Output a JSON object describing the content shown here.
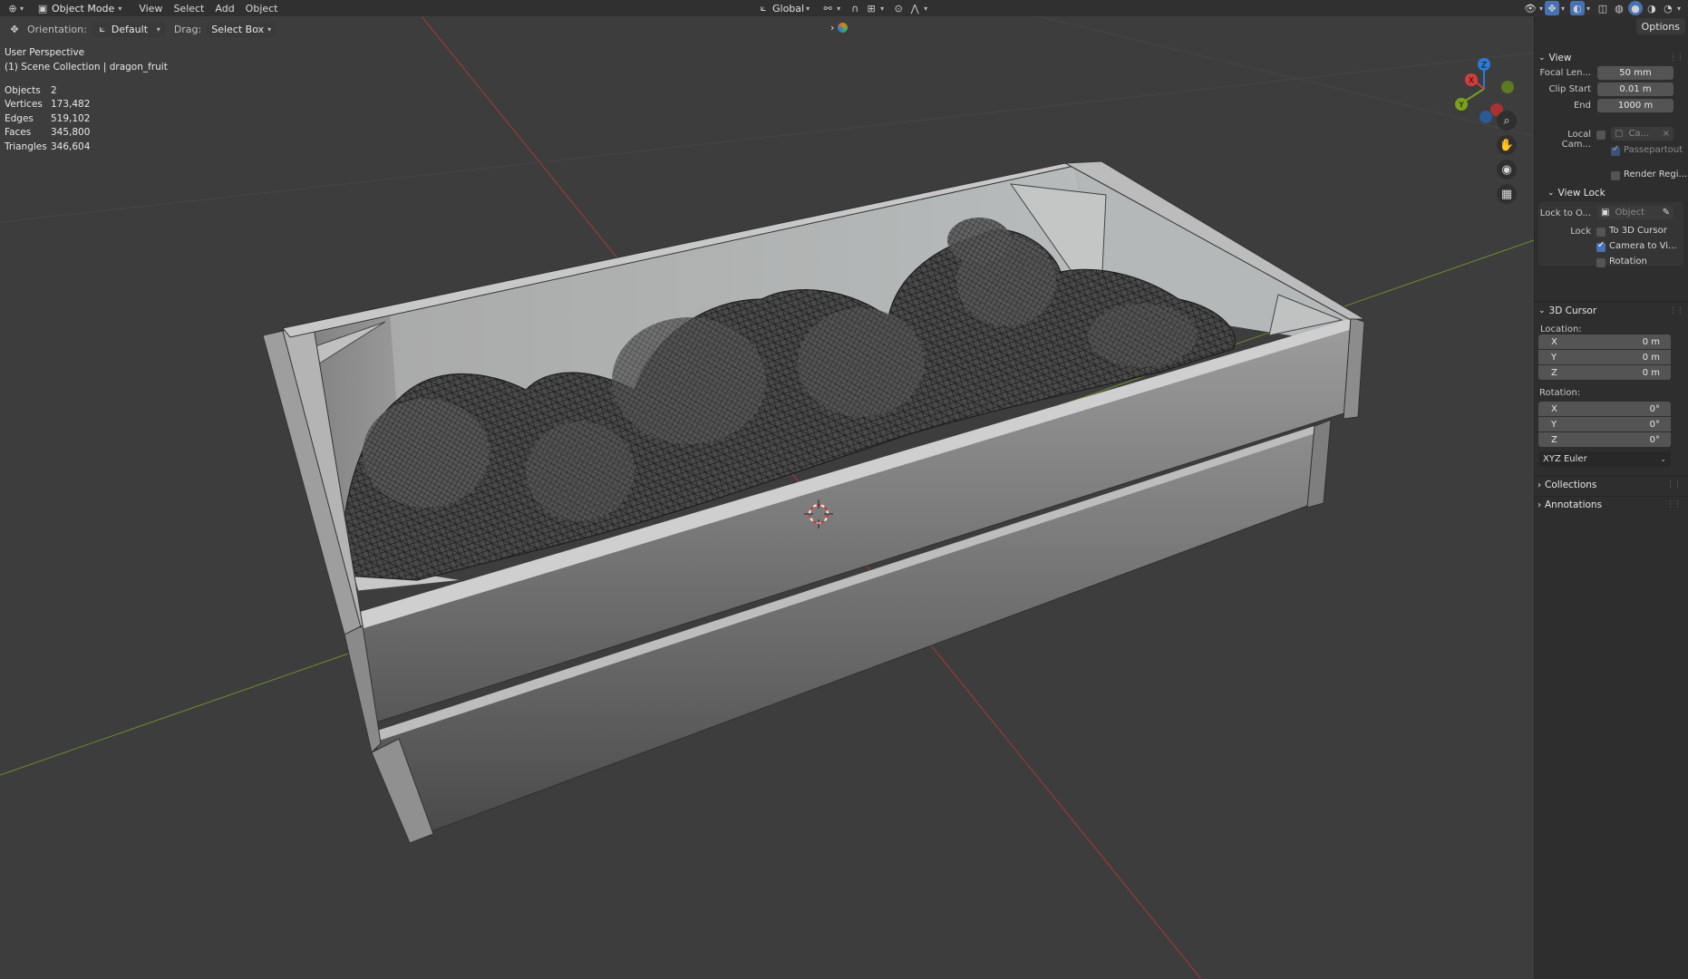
{
  "header": {
    "mode": "Object Mode",
    "menus": [
      "View",
      "Select",
      "Add",
      "Object"
    ],
    "transform_orientation": "Global"
  },
  "tool_settings": {
    "orientation_label": "Orientation:",
    "orientation_value": "Default",
    "drag_label": "Drag:",
    "drag_value": "Select Box"
  },
  "viewport": {
    "perspective": "User Perspective",
    "collection": "(1) Scene Collection | dragon_fruit",
    "stats": [
      {
        "label": "Objects",
        "value": "2"
      },
      {
        "label": "Vertices",
        "value": "173,482"
      },
      {
        "label": "Edges",
        "value": "519,102"
      },
      {
        "label": "Faces",
        "value": "345,800"
      },
      {
        "label": "Triangles",
        "value": "346,604"
      }
    ],
    "gizmo_axes": [
      "X",
      "Y",
      "Z"
    ]
  },
  "sidebar": {
    "options_label": "Options",
    "view": {
      "title": "View",
      "focal_label": "Focal Len...",
      "focal_value": "50 mm",
      "clip_start_label": "Clip Start",
      "clip_start_value": "0.01 m",
      "end_label": "End",
      "end_value": "1000 m",
      "local_camera_label": "Local Cam...",
      "local_camera_value": "Ca...",
      "passepartout_label": "Passepartout",
      "render_region_label": "Render Regi..."
    },
    "view_lock": {
      "title": "View Lock",
      "lock_to_object_label": "Lock to O...",
      "lock_to_object_placeholder": "Object",
      "lock_label": "Lock",
      "to_3d_cursor_label": "To 3D Cursor",
      "camera_to_view_label": "Camera to Vi...",
      "rotation_label": "Rotation"
    },
    "cursor": {
      "title": "3D Cursor",
      "location_label": "Location:",
      "location": [
        {
          "axis": "X",
          "value": "0 m"
        },
        {
          "axis": "Y",
          "value": "0 m"
        },
        {
          "axis": "Z",
          "value": "0 m"
        }
      ],
      "rotation_label": "Rotation:",
      "rotation": [
        {
          "axis": "X",
          "value": "0°"
        },
        {
          "axis": "Y",
          "value": "0°"
        },
        {
          "axis": "Z",
          "value": "0°"
        }
      ],
      "rotation_mode": "XYZ Euler"
    },
    "collections_title": "Collections",
    "annotations_title": "Annotations"
  },
  "colors": {
    "background": "#3d3d3d",
    "header": "#303030",
    "sidebar": "#2e2e2e",
    "accent": "#4772b3",
    "x_axis": "#d43d3d",
    "y_axis": "#7aa01e",
    "z_axis": "#2b7ad8"
  }
}
